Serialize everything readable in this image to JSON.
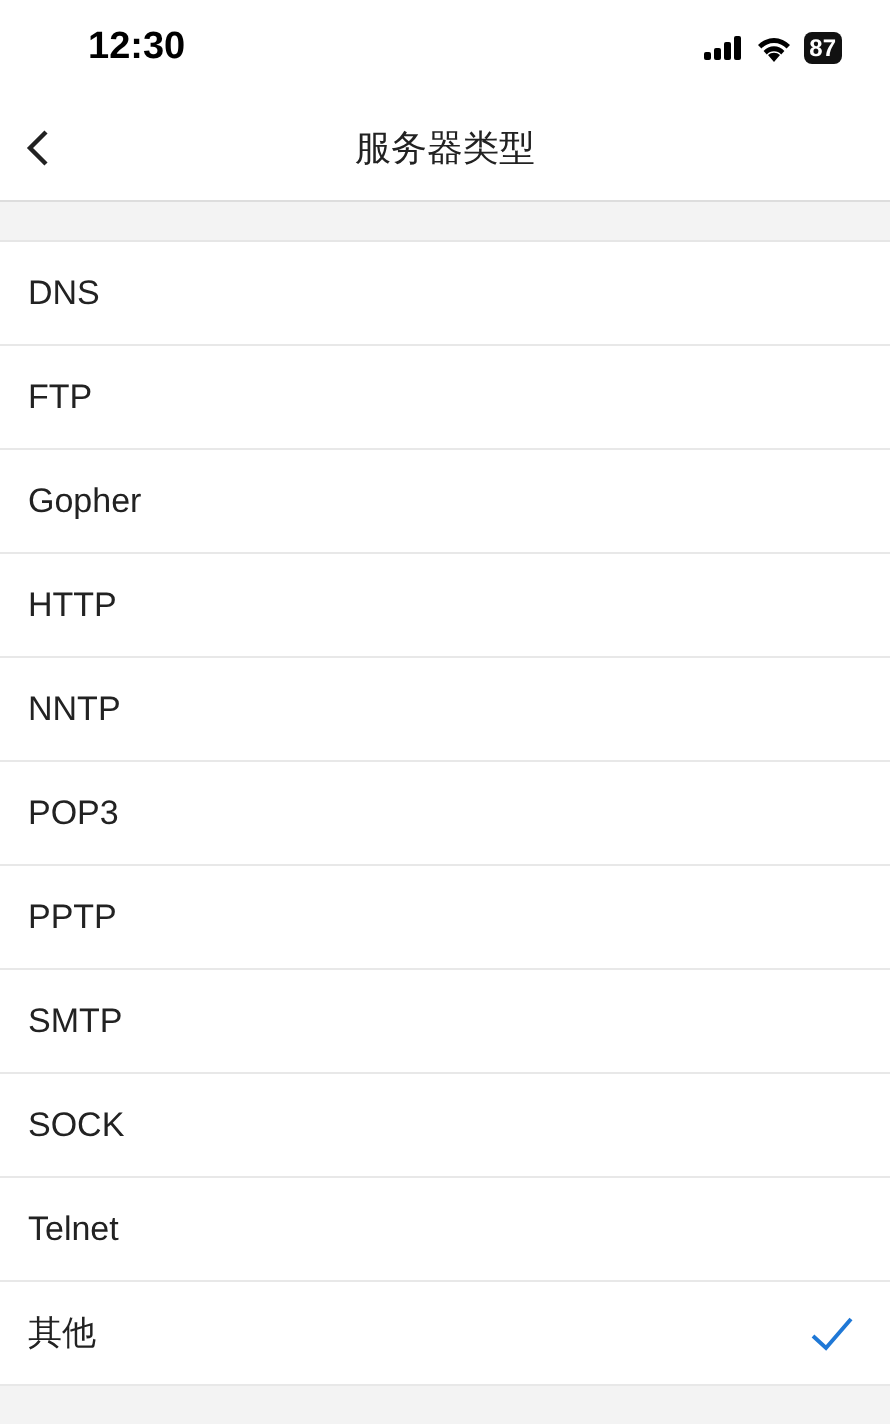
{
  "status_bar": {
    "time": "12:30",
    "battery": "87"
  },
  "nav": {
    "title": "服务器类型"
  },
  "options": [
    {
      "label": "DNS",
      "selected": false
    },
    {
      "label": "FTP",
      "selected": false
    },
    {
      "label": "Gopher",
      "selected": false
    },
    {
      "label": "HTTP",
      "selected": false
    },
    {
      "label": "NNTP",
      "selected": false
    },
    {
      "label": "POP3",
      "selected": false
    },
    {
      "label": "PPTP",
      "selected": false
    },
    {
      "label": "SMTP",
      "selected": false
    },
    {
      "label": "SOCK",
      "selected": false
    },
    {
      "label": "Telnet",
      "selected": false
    },
    {
      "label": "其他",
      "selected": true
    }
  ]
}
